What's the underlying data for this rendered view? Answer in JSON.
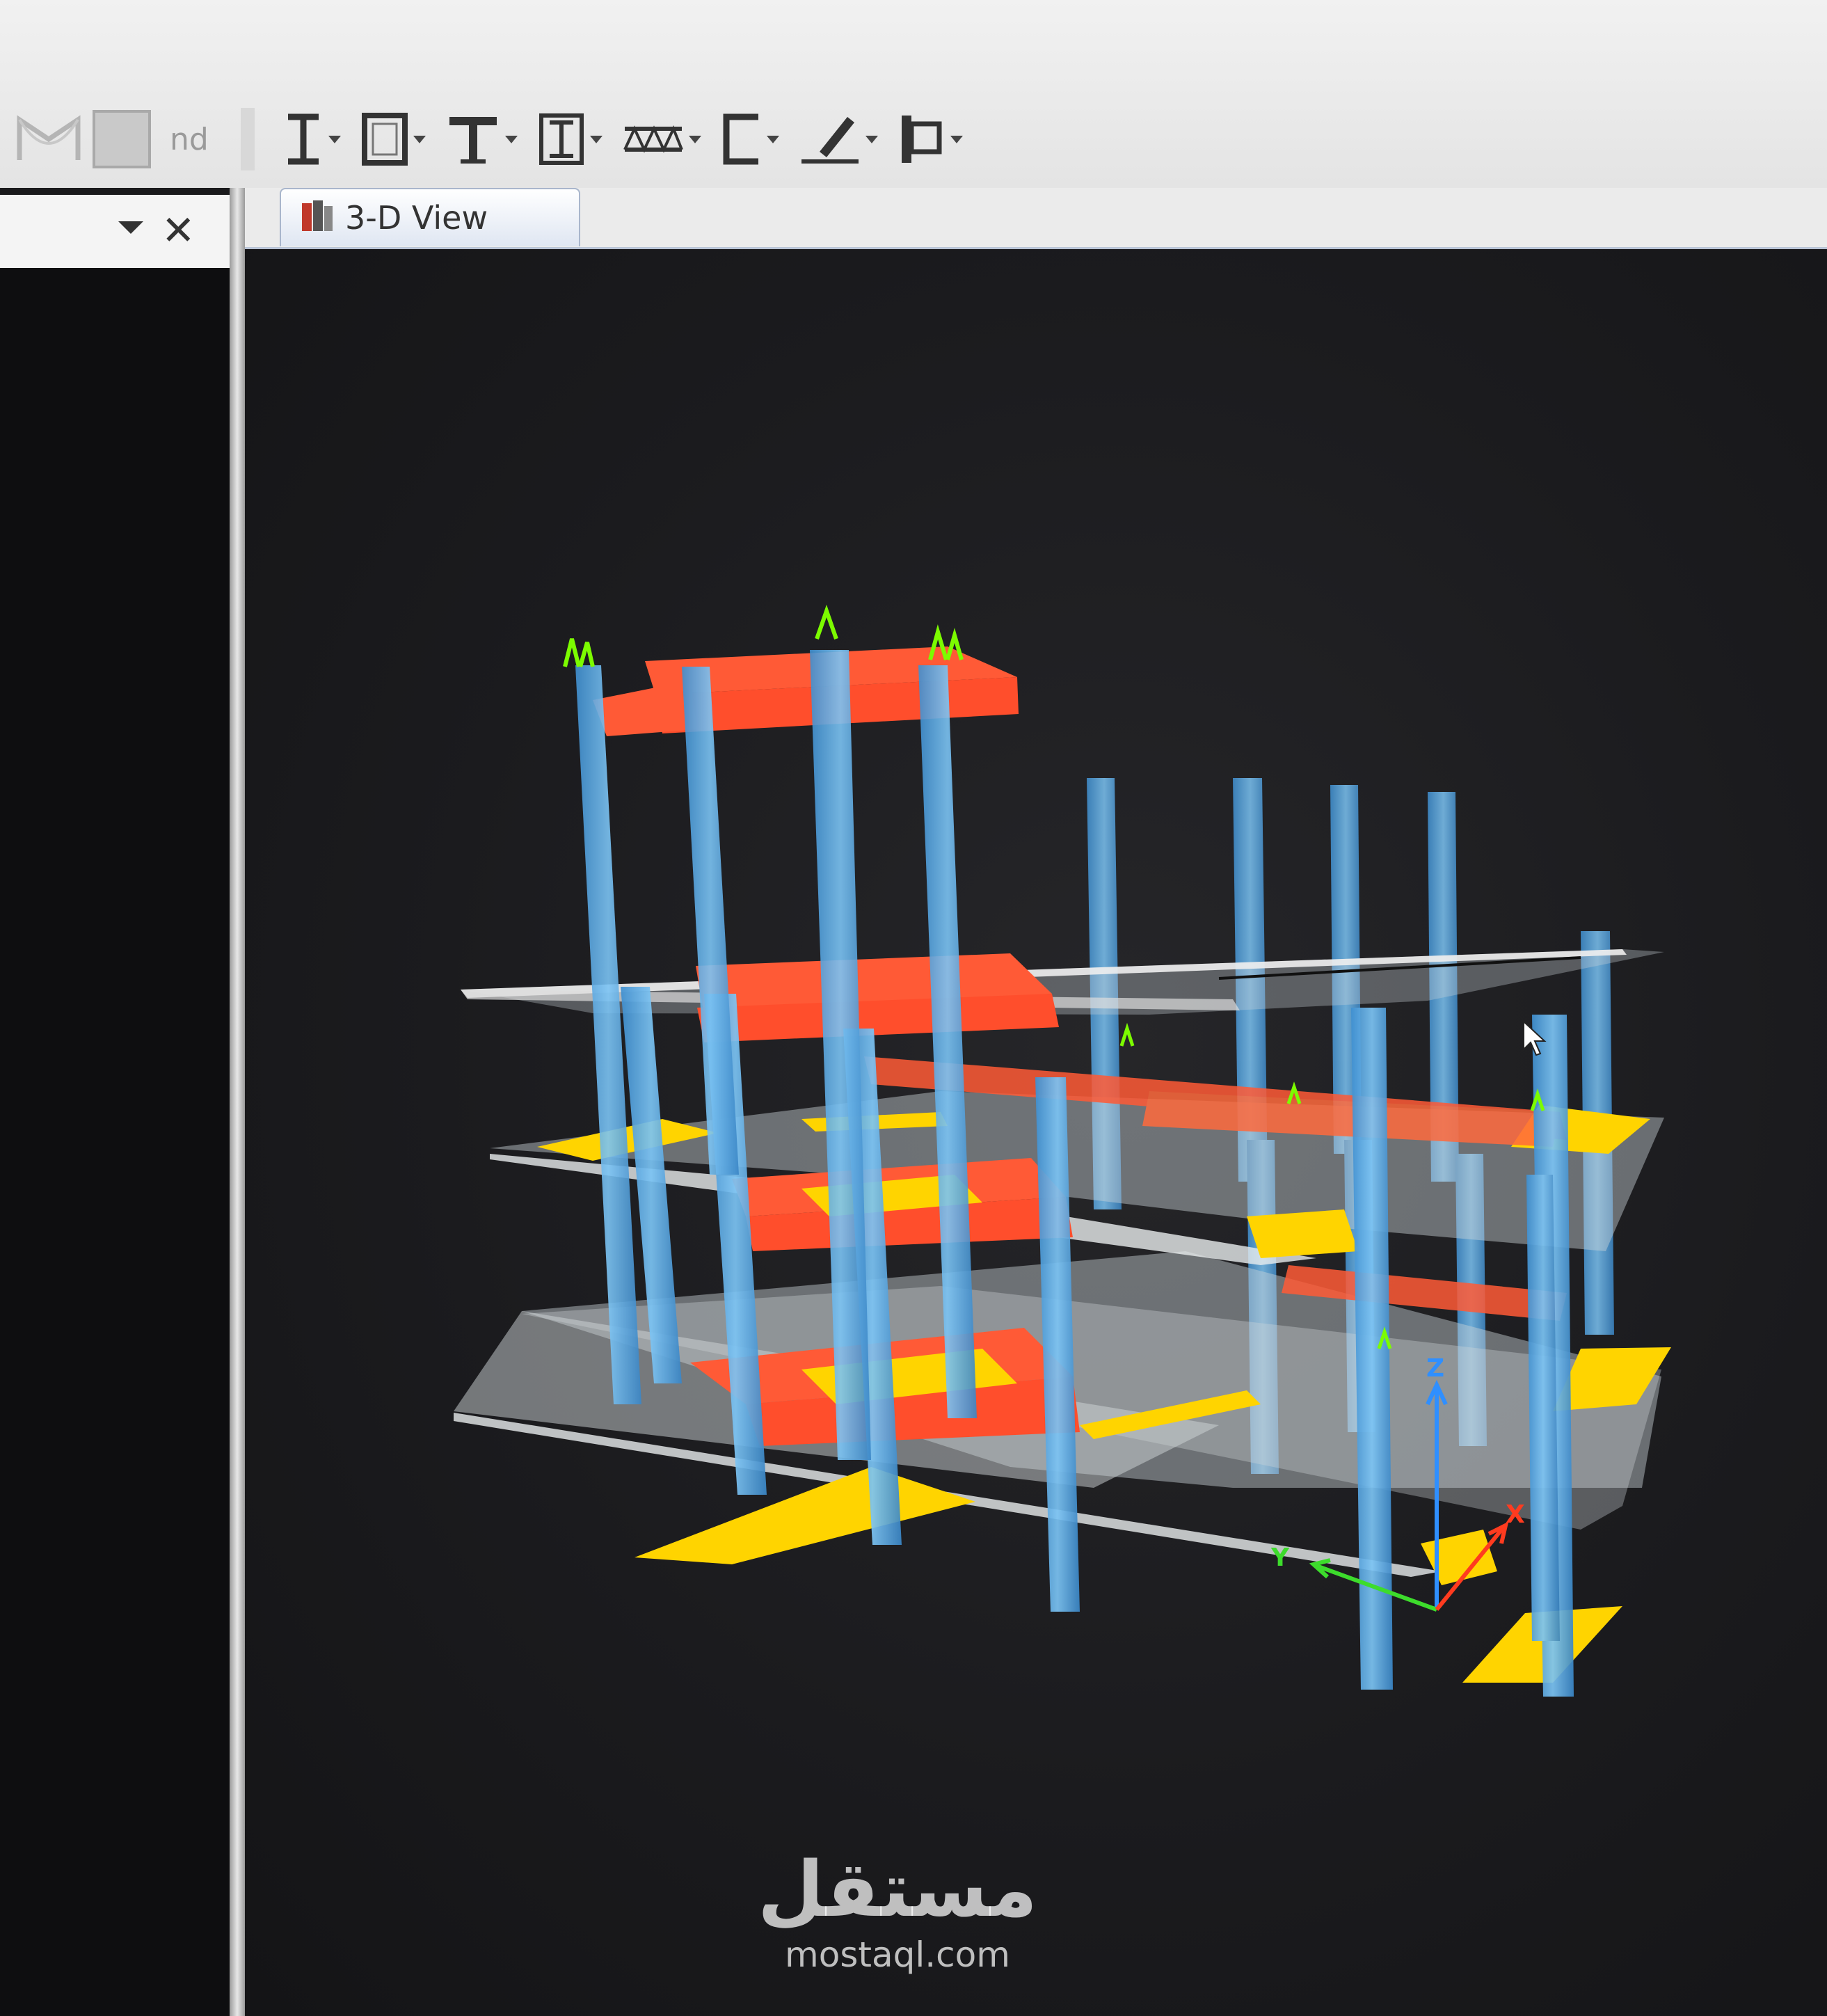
{
  "toolbar": {
    "tools": [
      {
        "icon": "moment-frame-icon"
      },
      {
        "icon": "shell-icon"
      },
      {
        "icon": "i-beam-icon",
        "dropdown": true
      },
      {
        "icon": "box-section-icon",
        "dropdown": true
      },
      {
        "icon": "tee-section-icon",
        "dropdown": true
      },
      {
        "icon": "double-i-icon",
        "dropdown": true
      },
      {
        "icon": "joist-icon",
        "dropdown": true
      },
      {
        "icon": "channel-section-icon",
        "dropdown": true
      },
      {
        "icon": "pen-draw-icon",
        "dropdown": true
      },
      {
        "icon": "plate-section-icon",
        "dropdown": true
      }
    ],
    "faded_label": "nd"
  },
  "panel": {
    "menu_icon": "chevron-down-icon",
    "close_glyph": "✕"
  },
  "tabs": [
    {
      "label": "3-D View",
      "icon": "3d-view-icon",
      "active": true
    }
  ],
  "viewport": {
    "axes": {
      "x_label": "X",
      "y_label": "Y",
      "z_label": "Z"
    },
    "colors": {
      "column": "#5aaee8",
      "beam": "#ff5a36",
      "slab_edge": "#ffd400",
      "slab": "#c9d2d6",
      "support": "#7cfc00",
      "axis_x": "#ff3b1f",
      "axis_y": "#3ddc2c",
      "axis_z": "#2f8fff"
    }
  },
  "watermark": {
    "arabic": "مستقل",
    "latin": "mostaql.com"
  }
}
